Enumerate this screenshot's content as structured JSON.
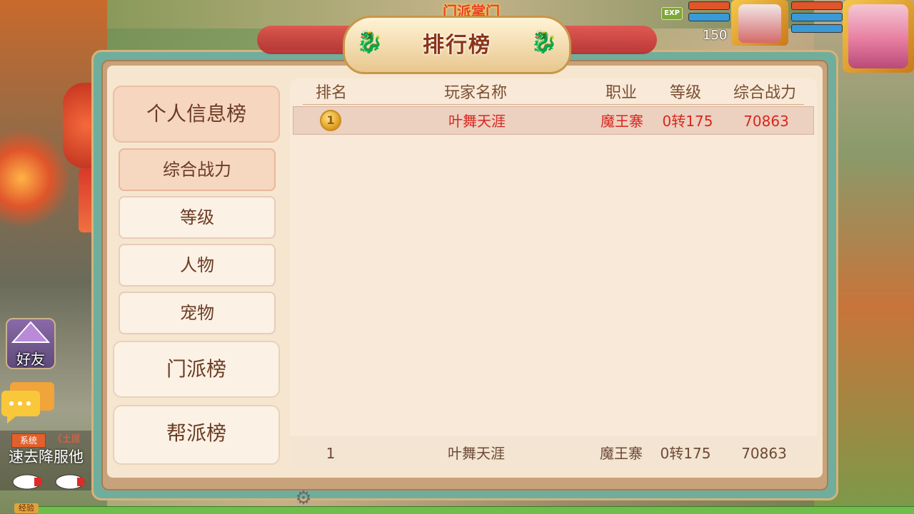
{
  "window": {
    "title": "排行榜",
    "top_banner": "门派掌门"
  },
  "hud": {
    "exp_badge": "EXP",
    "level": "150"
  },
  "nav": {
    "personal": "个人信息榜",
    "sub": [
      {
        "label": "综合战力",
        "active": true
      },
      {
        "label": "等级",
        "active": false
      },
      {
        "label": "人物",
        "active": false
      },
      {
        "label": "宠物",
        "active": false
      }
    ],
    "sect": "门派榜",
    "guild": "帮派榜"
  },
  "table": {
    "headers": [
      "排名",
      "玩家名称",
      "职业",
      "等级",
      "综合战力"
    ],
    "rows": [
      {
        "rank_icon": "gold-medal-icon",
        "name": "叶舞天涯",
        "job": "魔王寨",
        "level": "0转175",
        "power": "70863"
      }
    ],
    "my_rank": {
      "rank": "1",
      "name": "叶舞天涯",
      "job": "魔王寨",
      "level": "0转175",
      "power": "70863"
    }
  },
  "sidebar": {
    "friend": "好友"
  },
  "chat": {
    "system_tag": "系统",
    "link_text": "《土匪",
    "message": "速去降服他"
  },
  "footer": {
    "exp_label": "经验"
  },
  "colors": {
    "accent_red": "#d8271f",
    "panel_teal": "#6fae9c",
    "content_bg": "#f6e6cf"
  }
}
